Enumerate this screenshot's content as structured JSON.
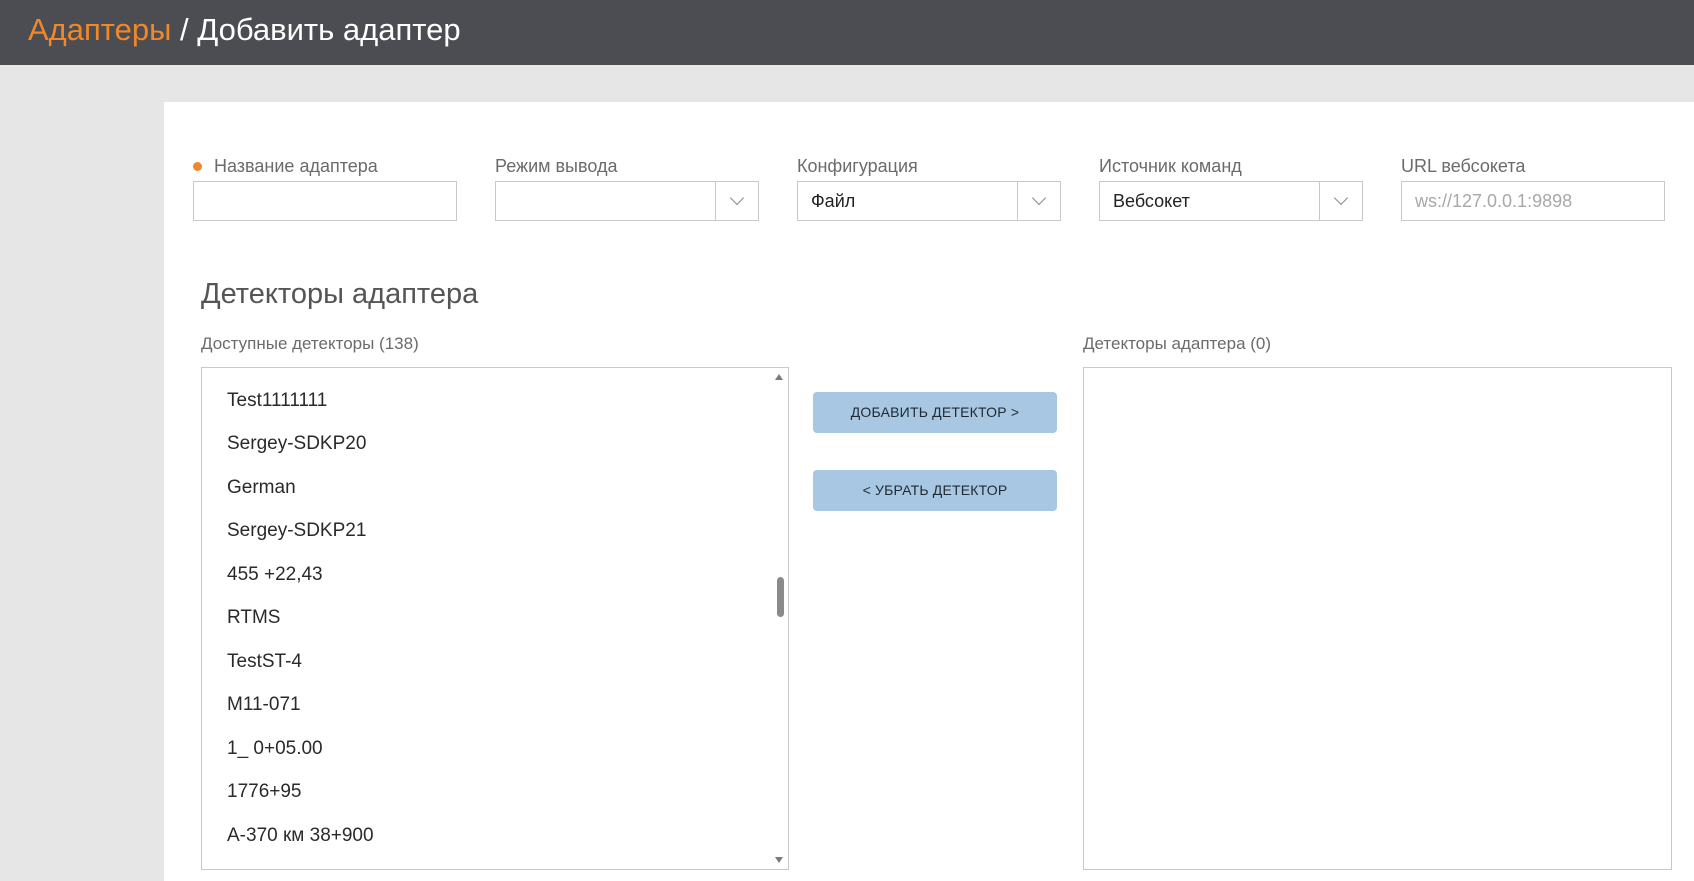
{
  "header": {
    "crumb_link": "Адаптеры",
    "crumb_separator": "/",
    "crumb_current": "Добавить адаптер",
    "bar_color": "#4b4d52",
    "accent_color": "#f0882a"
  },
  "form": {
    "adapter_name": {
      "label": "Название адаптера",
      "value": "",
      "required": true
    },
    "output_mode": {
      "label": "Режим вывода",
      "value": ""
    },
    "configuration": {
      "label": "Конфигурация",
      "value": "Файл"
    },
    "command_source": {
      "label": "Источник команд",
      "value": "Вебсокет"
    },
    "websocket_url": {
      "label": "URL вебсокета",
      "placeholder": "ws://127.0.0.1:9898"
    }
  },
  "detectors": {
    "section_title": "Детекторы адаптера",
    "available_label": "Доступные детекторы (138)",
    "available_items": [
      "Test1111111",
      "Sergey-SDKP20",
      "German",
      "Sergey-SDKP21",
      "455 +22,43",
      "RTMS",
      "TestST-4",
      "M11-071",
      "1_ 0+05.00",
      "1776+95",
      "А-370 км 38+900"
    ],
    "selected_label": "Детекторы адаптера (0)",
    "add_button": "ДОБАВИТЬ ДЕТЕКТОР >",
    "remove_button": "< УБРАТЬ ДЕТЕКТОР",
    "button_color": "#a7c7e2"
  }
}
